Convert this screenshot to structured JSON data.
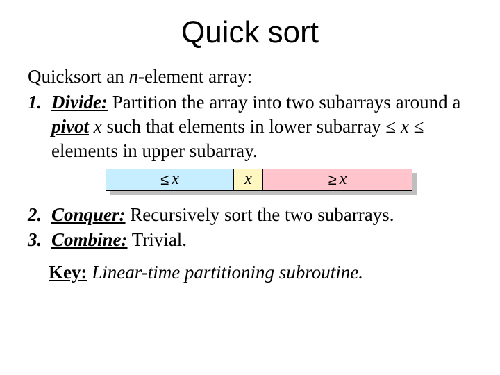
{
  "title": "Quick sort",
  "intro_prefix": "Quicksort an ",
  "intro_var": "n",
  "intro_suffix": "-element array:",
  "steps": [
    {
      "num": "1.",
      "keyword": "Divide:",
      "body_1": " Partition the array into two subarrays around a ",
      "pivot_word": "pivot",
      "body_1b": " ",
      "pivot_var": "x",
      "body_2": " such that elements in lower subarray ",
      "rel1_sym": "≤",
      "rel1_var": " x ",
      "rel2_sym": "≤",
      "body_3": " elements in upper subarray."
    },
    {
      "num": "2.",
      "keyword": "Conquer:",
      "body": " Recursively sort the two subarrays."
    },
    {
      "num": "3.",
      "keyword": "Combine:",
      "body": " Trivial."
    }
  ],
  "diagram": {
    "le_sym": "≤",
    "le_var": " x",
    "piv": "x",
    "ge_sym": "≥",
    "ge_var": " x"
  },
  "key": {
    "label": "Key:",
    "text": " Linear-time partitioning subroutine."
  }
}
